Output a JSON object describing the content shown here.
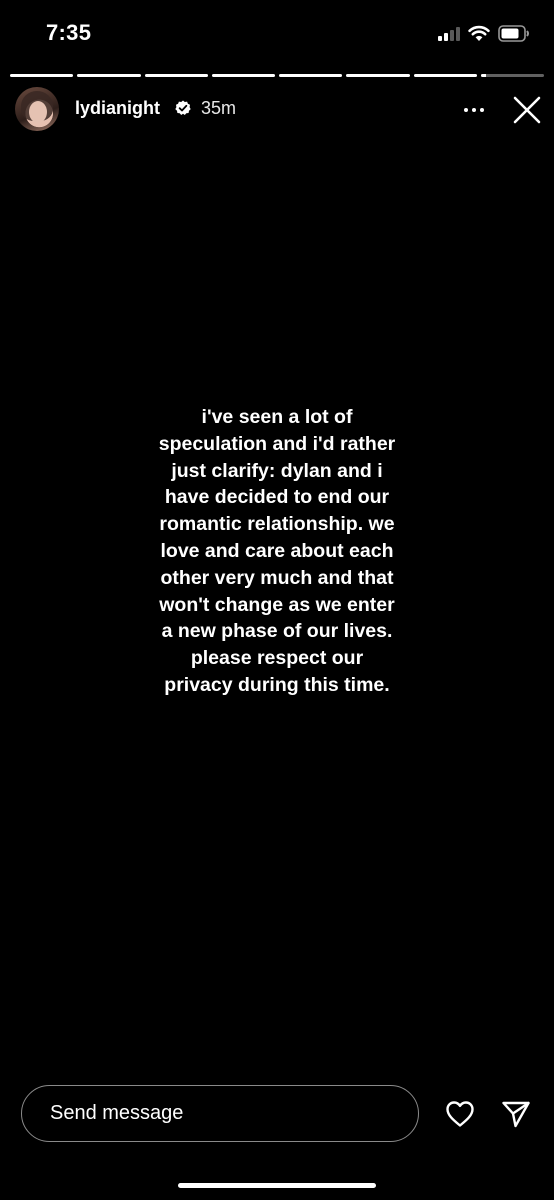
{
  "status_bar": {
    "time": "7:35",
    "icons": [
      "cellular-signal-icon",
      "wifi-icon",
      "battery-icon"
    ]
  },
  "story": {
    "segments_total": 8,
    "current_segment_index": 7,
    "current_segment_progress": 0.08,
    "username": "lydianight",
    "verified": true,
    "time_ago": "35m",
    "caption_lines": [
      "i've seen a lot of",
      "speculation and i'd rather",
      "just clarify: dylan and i",
      "have decided to end our",
      "romantic relationship. we",
      "love and care about each",
      "other very much and that",
      "won't change as we enter",
      "a new phase of our lives.",
      "please respect our",
      "privacy during this time."
    ]
  },
  "footer": {
    "reply_placeholder": "Send message"
  },
  "colors": {
    "background": "#000000",
    "text": "#ffffff",
    "field_border": "#8a8a8a"
  }
}
